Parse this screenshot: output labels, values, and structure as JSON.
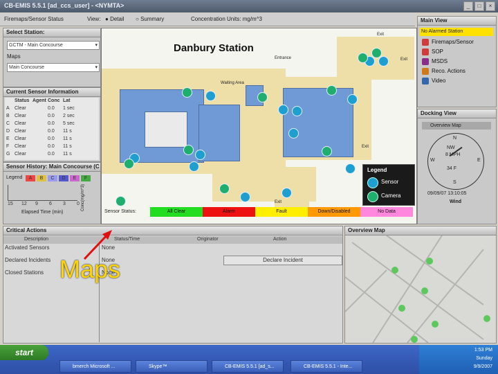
{
  "window": {
    "title": "CB-EMIS 5.5.1 [ad_ccs_user] - <NYMTA>"
  },
  "toolbar": {
    "left_label": "Firemaps/Sensor Status",
    "view_label": "View:",
    "detail": "Detail",
    "summary": "Summary",
    "units": "Concentration Units: mg/m^3"
  },
  "select_station": {
    "title": "Select Station:",
    "station": "GCTM - Main Concourse",
    "maps_label": "Maps",
    "map": "Main Concourse"
  },
  "current_sensor": {
    "title": "Current Sensor Information",
    "headers": [
      "",
      "Status",
      "Agent",
      "Conc",
      "Lat"
    ],
    "rows": [
      [
        "A",
        "Clear",
        "",
        "0.0",
        "1 sec"
      ],
      [
        "B",
        "Clear",
        "",
        "0.0",
        "2 sec"
      ],
      [
        "C",
        "Clear",
        "",
        "0.0",
        "5 sec"
      ],
      [
        "D",
        "Clear",
        "",
        "0.0",
        "11 s"
      ],
      [
        "E",
        "Clear",
        "",
        "0.0",
        "11 s"
      ],
      [
        "F",
        "Clear",
        "",
        "0.0",
        "11 s"
      ],
      [
        "G",
        "Clear",
        "",
        "0.0",
        "11 s"
      ]
    ]
  },
  "sensor_history": {
    "title": "Sensor History: Main Concourse (C",
    "legend_label": "Legend",
    "legend_items": [
      "A",
      "B",
      "C",
      "D",
      "E",
      "F"
    ],
    "x_ticks": [
      "15",
      "12",
      "9",
      "6",
      "3",
      "0"
    ],
    "xlabel": "Elapsed Time (min)",
    "ylabel": "Conc(mg/m^3)",
    "y_ticks": [
      "1",
      "0"
    ]
  },
  "map": {
    "title": "Danbury Station",
    "labels": {
      "entrance": "Entrance",
      "waiting": "Waiting Area",
      "exit1": "Exit",
      "exit2": "Exit",
      "exit3": "Exit",
      "exit4": "Exit"
    },
    "legend": {
      "title": "Legend",
      "sensor": "Sensor",
      "camera": "Camera"
    },
    "status_label": "Sensor Status:",
    "statuses": [
      {
        "label": "All Clear",
        "color": "#22dd22"
      },
      {
        "label": "Alarm",
        "color": "#ee1111"
      },
      {
        "label": "Fault",
        "color": "#ffee00"
      },
      {
        "label": "Down/Disabled",
        "color": "#ff9900"
      },
      {
        "label": "No Data",
        "color": "#ff88dd"
      }
    ]
  },
  "main_view": {
    "title": "Main View",
    "alarm": "No Alarmed Station",
    "items": [
      "Firemaps/Sensor",
      "SOP",
      "MSDS",
      "Reco. Actions",
      "Video"
    ]
  },
  "docking_view": {
    "title": "Docking View",
    "overview": "Overview Map",
    "compass": {
      "n": "N",
      "w": "W",
      "e": "E",
      "s": "S",
      "center": "NW",
      "speed": "8 MPH",
      "deg": "34 F"
    },
    "timestamp": "09/09/07 13:10:05",
    "wind": "Wind"
  },
  "critical_actions": {
    "title": "Critical Actions",
    "headers": [
      "Description",
      "Status/Time",
      "Originator",
      "Action"
    ],
    "rows": [
      {
        "desc": "Activated Sensors",
        "status": "None",
        "action": ""
      },
      {
        "desc": "Declared Incidents",
        "status": "None",
        "action": "Declare Incident"
      },
      {
        "desc": "Closed Stations",
        "status": "None",
        "action": ""
      }
    ]
  },
  "overview_map": {
    "title": "Overview Map"
  },
  "caption": "Maps",
  "taskbar": {
    "start": "start",
    "tasks": [
      "bmerch Microsoft ...",
      "Skype™",
      "CB-EMIS 5.5.1 [ad_s...",
      "CB-EMIS 5.5.1 - Inte..."
    ],
    "clock_time": "1:53 PM",
    "clock_day": "Sunday",
    "clock_date": "9/9/2007"
  }
}
